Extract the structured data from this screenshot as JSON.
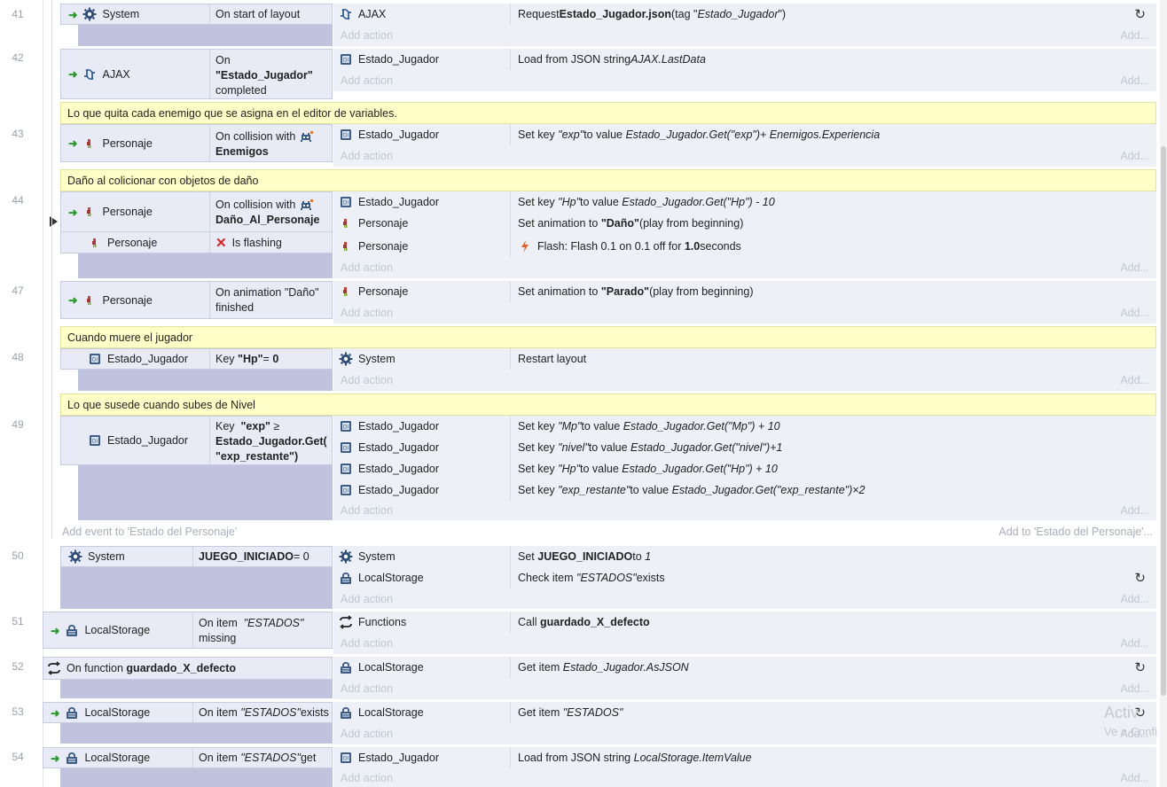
{
  "line_numbers": [
    "41",
    "42",
    "43",
    "44",
    "47",
    "48",
    "49",
    "50",
    "51",
    "52",
    "53",
    "54"
  ],
  "add_action": "Add action",
  "add_short": "Add...",
  "ev41": {
    "c_obj": "System",
    "c_txt": "On start of layout",
    "a_obj": "AJAX",
    "a_pre": "Request ",
    "a_b": "Estado_Jugador.json",
    "a_mid": " (tag \"",
    "a_i": "Estado_Jugador",
    "a_end": "\")"
  },
  "ev42": {
    "c_obj": "AJAX",
    "c_l1": "On",
    "c_l2": "\"Estado_Jugador\"",
    "c_l3": "completed",
    "a_obj": "Estado_Jugador",
    "a_pre": "Load from JSON string ",
    "a_i": "AJAX.LastData"
  },
  "com43": "Lo que quita cada enemigo que se asigna en el editor de variables.",
  "ev43": {
    "c_obj": "Personaje",
    "c_l1": "On collision with",
    "c_l2": "Enemigos",
    "a_obj": "Estado_Jugador",
    "a_pre": "Set key ",
    "a_k": "\"exp\"",
    "a_mid": " to value ",
    "a_i": "Estado_Jugador.Get(\"exp\")+ Enemigos.Experiencia"
  },
  "com44": "Daño al colicionar con objetos de daño",
  "ev44": {
    "c1_obj": "Personaje",
    "c1_l1": "On collision with",
    "c1_l2": "Daño_Al_Personaje",
    "c2_obj": "Personaje",
    "c2_txt": "Is flashing",
    "a1_obj": "Estado_Jugador",
    "a1_pre": "Set key ",
    "a1_k": "\"Hp\"",
    "a1_mid": " to value ",
    "a1_i": "Estado_Jugador.Get(\"Hp\") - 10",
    "a2_obj": "Personaje",
    "a2_pre": "Set animation to ",
    "a2_b": "\"Daño\"",
    "a2_end": " (play from beginning)",
    "a3_obj": "Personaje",
    "a3_pre": "Flash: Flash 0.1 on 0.1 off for ",
    "a3_b": "1.0",
    "a3_end": " seconds"
  },
  "ev47": {
    "c_obj": "Personaje",
    "c_l1": "On animation \"Daño\"",
    "c_l2": "finished",
    "a_obj": "Personaje",
    "a_pre": "Set animation to ",
    "a_b": "\"Parado\"",
    "a_end": " (play from beginning)"
  },
  "com48": "Cuando muere el jugador",
  "ev48": {
    "c_obj": "Estado_Jugador",
    "c_pre": "Key ",
    "c_b": "\"Hp\"",
    "c_mid": " = ",
    "c_b2": "0",
    "a_obj": "System",
    "a_txt": "Restart layout"
  },
  "com49": "Lo que susede cuando subes de Nivel",
  "ev49": {
    "c_obj": "Estado_Jugador",
    "c_l1a": "Key ",
    "c_l1b": "\"exp\"",
    "c_l1c": " ≥",
    "c_l2": "Estado_Jugador.Get(",
    "c_l3": "\"exp_restante\")",
    "a1_obj": "Estado_Jugador",
    "a1_pre": "Set key ",
    "a1_k": "\"Mp\"",
    "a1_mid": " to value ",
    "a1_i": "Estado_Jugador.Get(\"Mp\") + 10",
    "a2_obj": "Estado_Jugador",
    "a2_pre": "Set key ",
    "a2_k": "\"nivel\"",
    "a2_mid": " to value ",
    "a2_i": "Estado_Jugador.Get(\"nivel\")+1",
    "a3_obj": "Estado_Jugador",
    "a3_pre": "Set key ",
    "a3_k": "\"Hp\"",
    "a3_mid": " to value ",
    "a3_i": "Estado_Jugador.Get(\"Hp\") + 10",
    "a4_obj": "Estado_Jugador",
    "a4_pre": "Set key ",
    "a4_k": "\"exp_restante\"",
    "a4_mid": " to value ",
    "a4_i": "Estado_Jugador.Get(\"exp_restante\")×2"
  },
  "add_event": "Add event to 'Estado del Personaje'",
  "add_to": "Add to 'Estado del Personaje'...",
  "ev50": {
    "c_obj": "System",
    "c_b": "JUEGO_INICIADO",
    "c_end": " = 0",
    "a1_obj": "System",
    "a1_pre": "Set ",
    "a1_b": "JUEGO_INICIADO",
    "a1_mid": " to ",
    "a1_i": "1",
    "a2_obj": "LocalStorage",
    "a2_pre": "Check item ",
    "a2_i": "\"ESTADOS\"",
    "a2_end": " exists"
  },
  "ev51": {
    "c_obj": "LocalStorage",
    "c_l1a": "On item ",
    "c_l1b": "\"ESTADOS\"",
    "c_l2": "missing",
    "a_obj": "Functions",
    "a_pre": "Call ",
    "a_b": "guardado_X_defecto"
  },
  "ev52": {
    "c_pre": "On function ",
    "c_b": "guardado_X_defecto",
    "a_obj": "LocalStorage",
    "a_pre": "Get item ",
    "a_i": "Estado_Jugador.AsJSON"
  },
  "ev53": {
    "c_obj": "LocalStorage",
    "c_pre": "On item ",
    "c_i": "\"ESTADOS\"",
    "c_end": " exists",
    "a_obj": "LocalStorage",
    "a_pre": "Get item ",
    "a_i": "\"ESTADOS\""
  },
  "ev54": {
    "c_obj": "LocalStorage",
    "c_pre": "On item ",
    "c_i": "\"ESTADOS\"",
    "c_end": " get",
    "a_obj": "Estado_Jugador",
    "a_pre": "Load from JSON string ",
    "a_i": "LocalStorage.ItemValue"
  },
  "watermark_1": "Activ",
  "watermark_2": "Ve a Confi",
  "icons": [
    "gear-icon",
    "ajax-icon",
    "dictionary-icon",
    "sprite-icon",
    "localstorage-icon",
    "function-icon",
    "flash-icon",
    "x-icon",
    "sync-icon",
    "trigger-arrow-icon"
  ]
}
